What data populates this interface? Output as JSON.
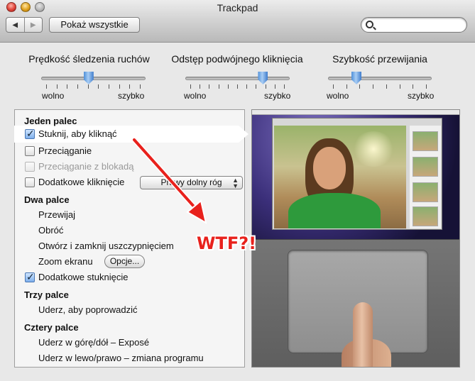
{
  "window": {
    "title": "Trackpad"
  },
  "toolbar": {
    "back_icon": "◀",
    "forward_icon": "▶",
    "show_all_label": "Pokaż wszystkie",
    "search_value": "",
    "search_placeholder": ""
  },
  "sliders": [
    {
      "title": "Prędkość śledzenia ruchów",
      "min_label": "wolno",
      "max_label": "szybko",
      "level": 0.45,
      "ticks": 10
    },
    {
      "title": "Odstęp podwójnego kliknięcia",
      "min_label": "wolno",
      "max_label": "szybko",
      "level": 0.77,
      "ticks": 11
    },
    {
      "title": "Szybkość przewijania",
      "min_label": "wolno",
      "max_label": "szybko",
      "level": 0.25,
      "ticks": 8
    }
  ],
  "gestures": {
    "one_finger": {
      "header": "Jeden palec",
      "tap_to_click": {
        "label": "Stuknij, aby kliknąć",
        "checked": true
      },
      "dragging": {
        "label": "Przeciąganie",
        "checked": false
      },
      "drag_lock": {
        "label": "Przeciąganie z blokadą",
        "checked": false,
        "disabled": true
      },
      "secondary_click": {
        "label": "Dodatkowe kliknięcie",
        "checked": false,
        "option": "Prawy dolny róg"
      }
    },
    "two_fingers": {
      "header": "Dwa palce",
      "scroll": "Przewijaj",
      "rotate": "Obróć",
      "pinch": "Otwórz i zamknij uszczypnięciem",
      "zoom": "Zoom ekranu",
      "zoom_options": "Opcje...",
      "secondary_tap": {
        "label": "Dodatkowe stuknięcie",
        "checked": true
      }
    },
    "three_fingers": {
      "header": "Trzy palce",
      "swipe": "Uderz, aby poprowadzić"
    },
    "four_fingers": {
      "header": "Cztery palce",
      "swipe_updown": "Uderz w górę/dół – Exposé",
      "swipe_leftright": "Uderz w lewo/prawo – zmiana programu"
    }
  },
  "annotation": {
    "text": "WTF?!",
    "color": "#e8211c"
  },
  "colors": {
    "accent": "#4f8fd9",
    "panel": "#f5f5f5",
    "window": "#e8e8e8"
  }
}
